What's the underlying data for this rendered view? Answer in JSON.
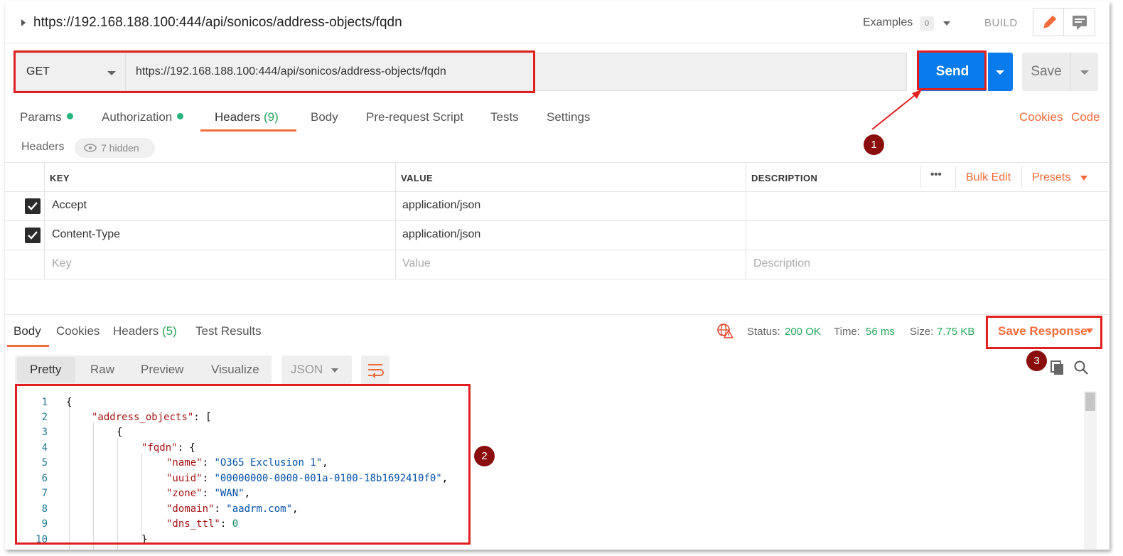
{
  "top": {
    "title_url": "https://192.168.188.100:444/api/sonicos/address-objects/fqdn",
    "examples_label": "Examples",
    "examples_count": "0",
    "build_label": "BUILD"
  },
  "request": {
    "method": "GET",
    "url": "https://192.168.188.100:444/api/sonicos/address-objects/fqdn",
    "send_label": "Send",
    "save_label": "Save"
  },
  "tabs": {
    "params": "Params",
    "authorization": "Authorization",
    "headers": "Headers",
    "headers_count": "(9)",
    "body": "Body",
    "prerequest": "Pre-request Script",
    "tests": "Tests",
    "settings": "Settings",
    "cookies": "Cookies",
    "code": "Code"
  },
  "headers_section": {
    "label": "Headers",
    "hidden": "7 hidden"
  },
  "table": {
    "col_key": "KEY",
    "col_value": "VALUE",
    "col_description": "DESCRIPTION",
    "more": "•••",
    "bulk_edit": "Bulk Edit",
    "presets": "Presets",
    "rows": [
      {
        "key": "Accept",
        "value": "application/json",
        "checked": true
      },
      {
        "key": "Content-Type",
        "value": "application/json",
        "checked": true
      }
    ],
    "placeholder_key": "Key",
    "placeholder_value": "Value",
    "placeholder_description": "Description"
  },
  "response": {
    "tab_body": "Body",
    "tab_cookies": "Cookies",
    "tab_headers": "Headers",
    "tab_headers_count": "(5)",
    "tab_tests": "Test Results",
    "status_label": "Status:",
    "status_value": "200 OK",
    "time_label": "Time:",
    "time_value": "56 ms",
    "size_label": "Size:",
    "size_value": "7.75 KB",
    "save_response": "Save Response",
    "fmt_pretty": "Pretty",
    "fmt_raw": "Raw",
    "fmt_preview": "Preview",
    "fmt_visualize": "Visualize",
    "fmt_lang": "JSON"
  },
  "code": {
    "line_numbers": [
      "1",
      "2",
      "3",
      "4",
      "5",
      "6",
      "7",
      "8",
      "9",
      "10"
    ],
    "l1": "{",
    "l2_key": "\"address_objects\"",
    "l2_rest": ": [",
    "l3": "{",
    "l4_key": "\"fqdn\"",
    "l4_rest": ": {",
    "l5_key": "\"name\"",
    "l5_val": "\"O365 Exclusion 1\"",
    "l6_key": "\"uuid\"",
    "l6_val": "\"00000000-0000-001a-0100-18b1692410f0\"",
    "l7_key": "\"zone\"",
    "l7_val": "\"WAN\"",
    "l8_key": "\"domain\"",
    "l8_val": "\"aadrm.com\"",
    "l9_key": "\"dns_ttl\"",
    "l9_val": "0",
    "l10": "}"
  },
  "annotations": {
    "b1": "1",
    "b2": "2",
    "b3": "3"
  },
  "colors": {
    "accent": "#f26b3a",
    "send": "#097bed",
    "annotation": "#e02020",
    "badge": "#8b0e0e"
  }
}
